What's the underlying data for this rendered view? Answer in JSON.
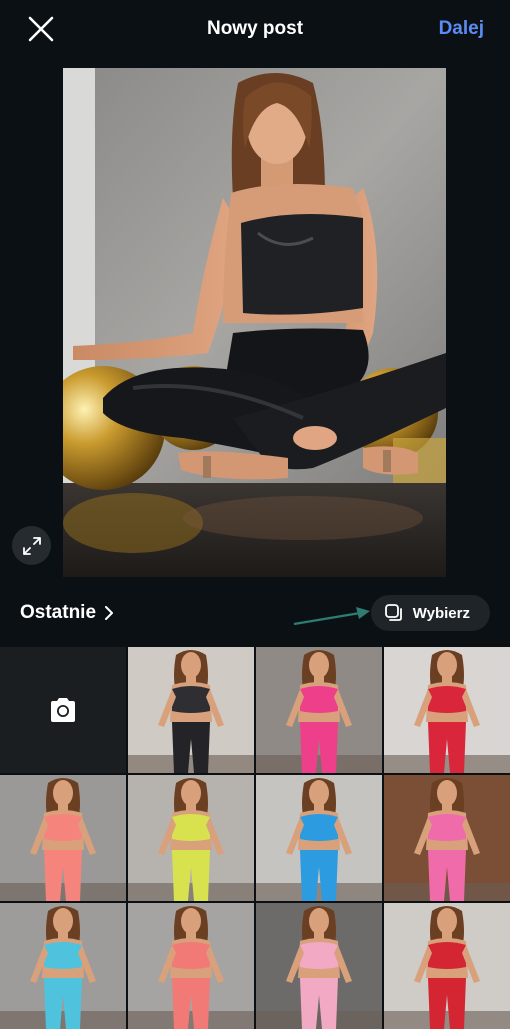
{
  "header": {
    "title": "Nowy post",
    "next_label": "Dalej",
    "accent_color": "#5b8cf5"
  },
  "preview": {
    "image": "woman-in-black-sportswear-sitting-cross-legged-with-gold-balloons"
  },
  "gallery": {
    "album_label": "Ostatnie",
    "select_label": "Wybierz",
    "camera_icon": "camera-icon",
    "thumbnails": [
      {
        "name": "black-outfit",
        "top": "#2f2f33",
        "bottom": "#242428",
        "bg": "#cfcac4"
      },
      {
        "name": "pink-outfit",
        "top": "#ee3f8a",
        "bottom": "#ee3f8a",
        "bg": "#8f8a86"
      },
      {
        "name": "red-outfit",
        "top": "#d9263a",
        "bottom": "#d9263a",
        "bg": "#d8d5d2"
      },
      {
        "name": "coral-outfit",
        "top": "#f5857c",
        "bottom": "#f5857c",
        "bg": "#9a9998"
      },
      {
        "name": "lime-outfit",
        "top": "#d8e24f",
        "bottom": "#d8e24f",
        "bg": "#b6b3ae"
      },
      {
        "name": "blue-outfit-skateboard",
        "top": "#2c9be0",
        "bottom": "#2c9be0",
        "bg": "#c6c4c0"
      },
      {
        "name": "pink-outfit-teddy-bear",
        "top": "#f06ba9",
        "bottom": "#f06ba9",
        "bg": "#7a4f35"
      },
      {
        "name": "turquoise-outfit",
        "top": "#4fc3dd",
        "bottom": "#4fc3dd",
        "bg": "#9d9c9b"
      },
      {
        "name": "coral-outfit-2",
        "top": "#f17a76",
        "bottom": "#f17a76",
        "bg": "#a5a4a3"
      },
      {
        "name": "light-pink-outfit",
        "top": "#f2a9c4",
        "bottom": "#f2a9c4",
        "bg": "#6d6b69"
      },
      {
        "name": "red-outfit-2",
        "top": "#d42533",
        "bottom": "#d42533",
        "bg": "#cfccc8"
      }
    ]
  }
}
